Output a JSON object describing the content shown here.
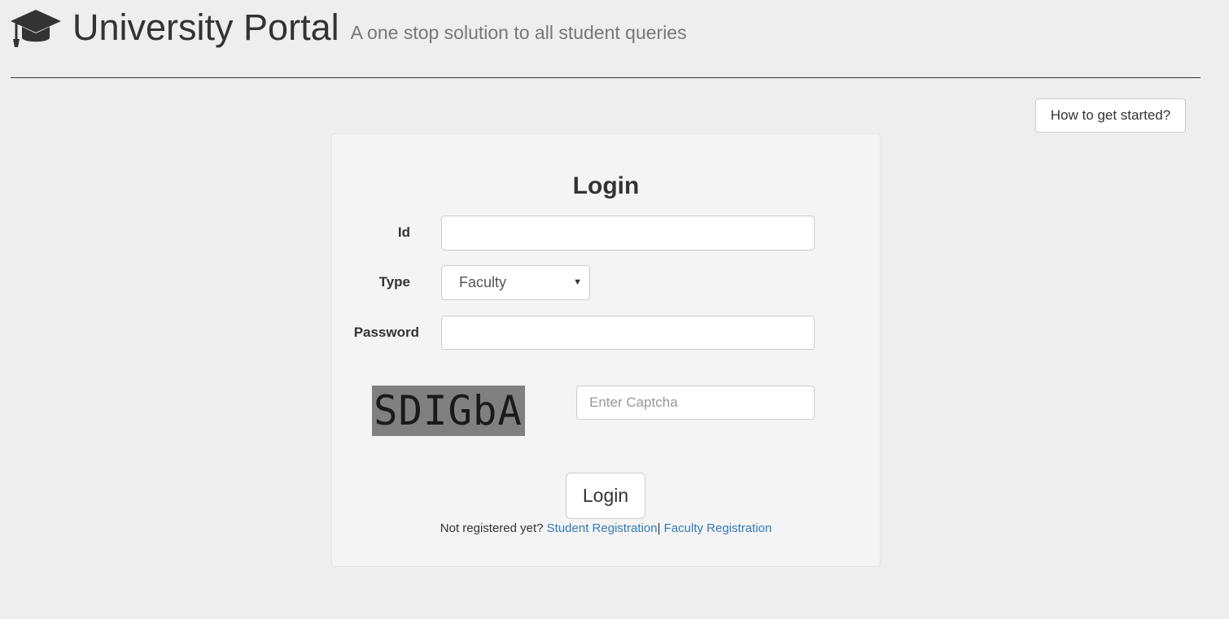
{
  "header": {
    "title": "University Portal",
    "subtitle": "A one stop solution to all student queries",
    "icon": "graduation-cap-icon"
  },
  "help_button": {
    "label": "How to get started?"
  },
  "login_form": {
    "title": "Login",
    "id_label": "Id",
    "id_value": "",
    "type_label": "Type",
    "type_selected": "Faculty",
    "password_label": "Password",
    "password_value": "",
    "captcha_text": "SDIGbA",
    "captcha_placeholder": "Enter Captcha",
    "submit_label": "Login",
    "not_registered_text": "Not registered yet?",
    "student_registration_link": "Student Registration",
    "separator": "|",
    "faculty_registration_link": "Faculty Registration"
  },
  "colors": {
    "background": "#eeeeee",
    "panel": "#f4f4f4",
    "link": "#337ab7",
    "captcha_bg": "#808080"
  }
}
